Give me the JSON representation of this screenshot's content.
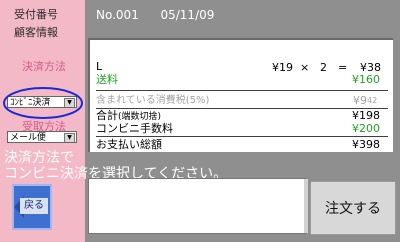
{
  "sidebar": {
    "reception_number_label": "受付番号",
    "customer_info_label": "顧客情報",
    "payment_method_label": "決済方法",
    "payment_method_value": "ｺﾝﾋﾞﾆ決済",
    "receive_method_label": "受取方法",
    "receive_method_value": "メール便"
  },
  "header": {
    "order_no": "No.001",
    "date": "05/11/09"
  },
  "receipt": {
    "item_code": "L",
    "unit_price": "¥19",
    "times": "×",
    "qty": "2",
    "equals": "=",
    "item_total": "¥38",
    "shipping_label": "送料",
    "shipping_value": "¥160",
    "tax_label": "含まれている消費税(5%)",
    "tax_value": "¥9",
    "tax_decimal": "42",
    "subtotal_label": "合計",
    "subtotal_note": "(端数切捨)",
    "subtotal_value": "¥198",
    "fee_label": "コンビニ手数料",
    "fee_value": "¥200",
    "total_label": "お支払い総額",
    "total_value": "¥398"
  },
  "message": {
    "line1": "決済方法で",
    "line2": "コンビニ決済を選択してください。"
  },
  "buttons": {
    "back_label": "戻る",
    "order_label": "注文する"
  },
  "colors": {
    "sidebar_bg": "#f3b9c6",
    "main_bg": "#8f8f8f",
    "accent_green": "#21a321",
    "highlight_circle": "#1a2ad6",
    "back_button_blue": "#3f6fcf"
  },
  "icons": {
    "back": "left-arrow-icon"
  }
}
